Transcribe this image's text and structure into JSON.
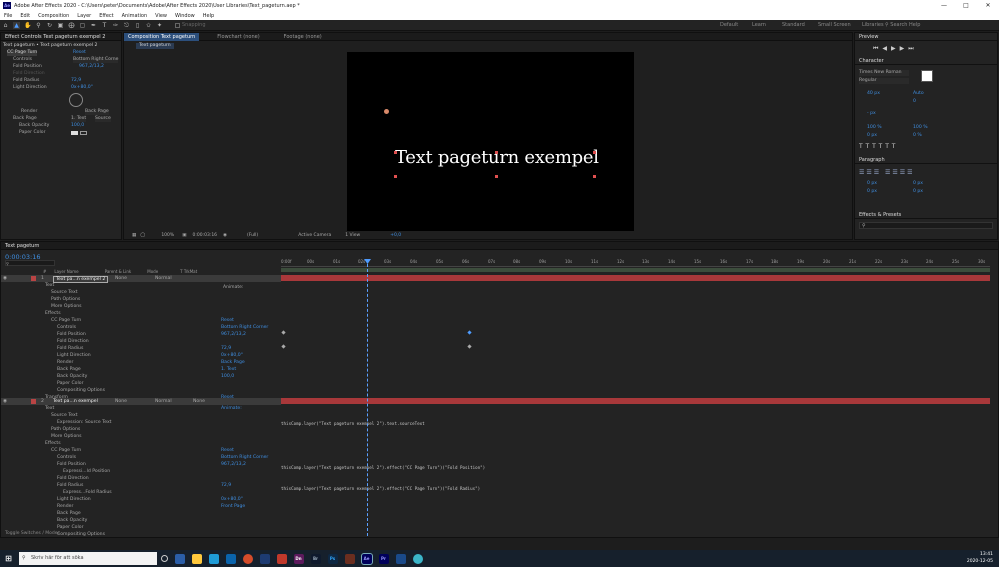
{
  "window": {
    "title": "Adobe After Effects 2020 - C:\\Users\\peter\\Documents\\Adobe\\After Effects 2020\\User Libraries\\Text_pageturn.aep *"
  },
  "menu": [
    "File",
    "Edit",
    "Composition",
    "Layer",
    "Effect",
    "Animation",
    "View",
    "Window",
    "Help"
  ],
  "toolbar": {
    "snapping": "Snapping",
    "workspaces": [
      "Default",
      "Learn",
      "Standard",
      "Small Screen",
      "Libraries"
    ],
    "search": "Search Help"
  },
  "effect_controls": {
    "tab": "Effect Controls Text pageturn exempel 2",
    "header": "Text pageturn • Text pageturn exempel 2",
    "rows": [
      {
        "label": "CC Page Turn",
        "value": "Reset"
      },
      {
        "label": "Controls",
        "value": "Bottom Right Corne"
      },
      {
        "label": "Fold Position",
        "value": "967,2/13,2"
      },
      {
        "label": "Fold Direction",
        "value": ""
      },
      {
        "label": "Fold Radius",
        "value": "72,9"
      },
      {
        "label": "Light Direction",
        "value": "0x+80,0°"
      },
      {
        "label": "Render",
        "value": "Back Page"
      },
      {
        "label": "Back Page",
        "value": "1. Text"
      },
      {
        "label": "Back Opacity",
        "value": "100,0"
      },
      {
        "label": "Paper Color",
        "value": ""
      }
    ],
    "back_page_source": "Source"
  },
  "composition": {
    "tab": "Composition Text pageturn",
    "flowchart": "Flowchart (none)",
    "footage": "Footage (none)",
    "breadcrumb": "Text pageturn",
    "text": "Text pageturn exempel",
    "zoom": "100%",
    "time": "0:00:03:16",
    "resolution": "(Full)",
    "camera": "Active Camera",
    "views": "1 View",
    "exposure": "+0,0"
  },
  "right": {
    "preview": "Preview",
    "character": "Character",
    "font": "Times New Roman",
    "style": "Regular",
    "size": "40 px",
    "leading": "Auto",
    "tracking": "0",
    "kerning": "",
    "stroke": "- px",
    "vscale": "100 %",
    "hscale": "100 %",
    "baseline": "0 px",
    "tsume": "0 %",
    "paragraph": "Paragraph",
    "indent": [
      "0 px",
      "0 px",
      "0 px",
      "0 px",
      "0 px"
    ],
    "effects": "Effects & Presets"
  },
  "timeline": {
    "tab": "Text pageturn",
    "time": "0:00:03:16",
    "columns": [
      "#",
      "Layer Name",
      "Parent & Link",
      "Mode",
      "T TrkMat"
    ],
    "ruler": [
      "0:00f",
      "00s",
      "01s",
      "02s",
      "03s",
      "04s",
      "05s",
      "06s",
      "07s",
      "08s",
      "09s",
      "10s",
      "11s",
      "12s",
      "13s",
      "14s",
      "15s",
      "16s",
      "17s",
      "18s",
      "19s",
      "20s",
      "21s",
      "22s",
      "23s",
      "24s",
      "25s",
      "30s"
    ],
    "layer1": {
      "num": "1",
      "name": "Text pa...n exempel 2",
      "parent": "None",
      "mode": "Normal"
    },
    "layer2": {
      "num": "2",
      "name": "Text pa...n exempel",
      "parent": "None",
      "mode": "Normal",
      "trkmat": "None"
    },
    "rows1": [
      {
        "indent": 1,
        "label": "Text",
        "value": ""
      },
      {
        "indent": 2,
        "label": "Source Text",
        "value": ""
      },
      {
        "indent": 2,
        "label": "Path Options",
        "value": ""
      },
      {
        "indent": 2,
        "label": "More Options",
        "value": ""
      },
      {
        "indent": 1,
        "label": "Effects",
        "value": ""
      },
      {
        "indent": 2,
        "label": "CC Page Turn",
        "value": "Reset"
      },
      {
        "indent": 3,
        "label": "Controls",
        "value": "Bottom Right Corner"
      },
      {
        "indent": 3,
        "label": "Fold Position",
        "value": "967,2/13,2"
      },
      {
        "indent": 3,
        "label": "Fold Direction",
        "value": ""
      },
      {
        "indent": 3,
        "label": "Fold Radius",
        "value": "72,9"
      },
      {
        "indent": 3,
        "label": "Light Direction",
        "value": "0x+80,0°"
      },
      {
        "indent": 3,
        "label": "Render",
        "value": "Back Page"
      },
      {
        "indent": 3,
        "label": "Back Page",
        "value": "1. Text"
      },
      {
        "indent": 3,
        "label": "Back Opacity",
        "value": "100,0"
      },
      {
        "indent": 3,
        "label": "Paper Color",
        "value": ""
      },
      {
        "indent": 3,
        "label": "Compositing Options",
        "value": ""
      },
      {
        "indent": 1,
        "label": "Transform",
        "value": "Reset"
      }
    ],
    "rows2": [
      {
        "indent": 1,
        "label": "Text",
        "value": "Animate:"
      },
      {
        "indent": 2,
        "label": "Source Text",
        "value": ""
      },
      {
        "indent": 3,
        "label": "Expression: Source Text",
        "value": ""
      },
      {
        "indent": 2,
        "label": "Path Options",
        "value": ""
      },
      {
        "indent": 2,
        "label": "More Options",
        "value": ""
      },
      {
        "indent": 1,
        "label": "Effects",
        "value": ""
      },
      {
        "indent": 2,
        "label": "CC Page Turn",
        "value": "Reset"
      },
      {
        "indent": 3,
        "label": "Controls",
        "value": "Bottom Right Corner"
      },
      {
        "indent": 3,
        "label": "Fold Position",
        "value": "967,2/13,2"
      },
      {
        "indent": 4,
        "label": "Expressi...ld Position",
        "value": ""
      },
      {
        "indent": 3,
        "label": "Fold Direction",
        "value": ""
      },
      {
        "indent": 3,
        "label": "Fold Radius",
        "value": "72,9"
      },
      {
        "indent": 4,
        "label": "Express...Fold Radius",
        "value": ""
      },
      {
        "indent": 3,
        "label": "Light Direction",
        "value": "0x+80,0°"
      },
      {
        "indent": 3,
        "label": "Render",
        "value": "Front Page"
      },
      {
        "indent": 3,
        "label": "Back Page",
        "value": ""
      },
      {
        "indent": 3,
        "label": "Back Opacity",
        "value": ""
      },
      {
        "indent": 3,
        "label": "Paper Color",
        "value": ""
      },
      {
        "indent": 3,
        "label": "Compositing Options",
        "value": ""
      }
    ],
    "animate": "Animate:",
    "expr1": "thisComp.layer(\"Text pageturn exempel 2\").text.sourceText",
    "expr2": "thisComp.layer(\"Text pageturn exempel 2\").effect(\"CC Page Turn\")(\"Fold Position\")",
    "expr3": "thisComp.layer(\"Text pageturn exempel 2\").effect(\"CC Page Turn\")(\"Fold Radius\")",
    "footer": "Toggle Switches / Modes"
  },
  "taskbar": {
    "search": "Skriv här för att söka",
    "time": "13:41",
    "date": "2020-12-05"
  }
}
